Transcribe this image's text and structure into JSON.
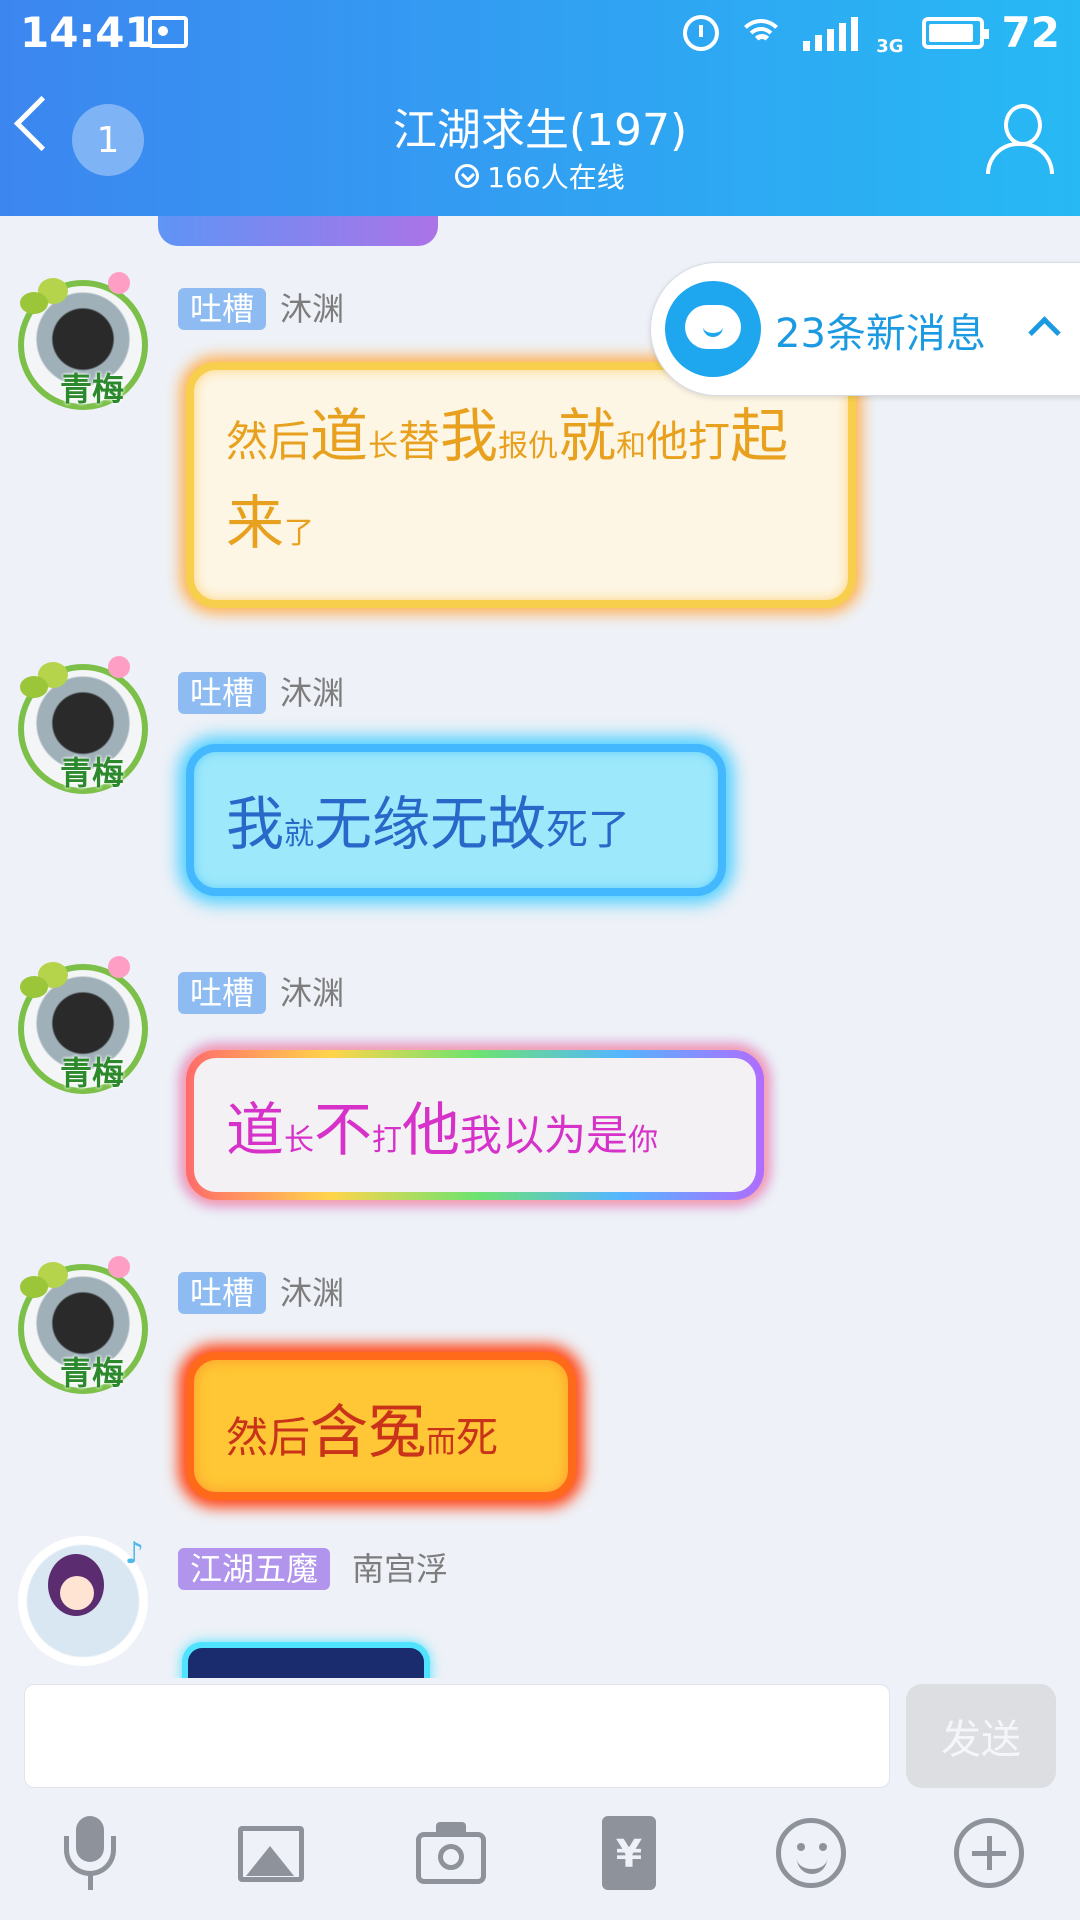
{
  "status_bar": {
    "time": "14:41",
    "network": "3G",
    "battery": "72"
  },
  "header": {
    "unread_count": "1",
    "title": "江湖求生(197)",
    "online": "166人在线"
  },
  "new_messages": {
    "label": "23条新消息"
  },
  "messages": [
    {
      "badge": "吐槽",
      "name": "沐渊",
      "segments": [
        {
          "t": "然后",
          "s": "m"
        },
        {
          "t": "道",
          "s": "l"
        },
        {
          "t": "长",
          "s": "s"
        },
        {
          "t": "替",
          "s": "m"
        },
        {
          "t": "我",
          "s": "l"
        },
        {
          "t": "报仇",
          "s": "s"
        },
        {
          "t": "就",
          "s": "l"
        },
        {
          "t": "和",
          "s": "s"
        },
        {
          "t": "他打",
          "s": "m"
        },
        {
          "t": "起来",
          "s": "l"
        },
        {
          "t": "了",
          "s": "s"
        }
      ]
    },
    {
      "badge": "吐槽",
      "name": "沐渊",
      "segments": [
        {
          "t": "我",
          "s": "l"
        },
        {
          "t": "就",
          "s": "s"
        },
        {
          "t": "无缘无故",
          "s": "l"
        },
        {
          "t": "死了",
          "s": "m"
        }
      ]
    },
    {
      "badge": "吐槽",
      "name": "沐渊",
      "segments": [
        {
          "t": "道",
          "s": "l"
        },
        {
          "t": "长",
          "s": "s"
        },
        {
          "t": "不",
          "s": "l"
        },
        {
          "t": "打",
          "s": "s"
        },
        {
          "t": "他",
          "s": "l"
        },
        {
          "t": "我以为是",
          "s": "m"
        },
        {
          "t": "你",
          "s": "s"
        }
      ]
    },
    {
      "badge": "吐槽",
      "name": "沐渊",
      "segments": [
        {
          "t": "然后",
          "s": "m"
        },
        {
          "t": "含冤",
          "s": "l"
        },
        {
          "t": "而",
          "s": "s"
        },
        {
          "t": "死",
          "s": "m"
        }
      ]
    },
    {
      "badge": "江湖五魔",
      "name": "南宫浮",
      "segments": []
    }
  ],
  "avatar_tag": "青梅",
  "composer": {
    "input_value": "",
    "send_label": "发送"
  },
  "toolbar": {
    "red_packet_symbol": "¥"
  },
  "colors": {
    "header_start": "#3c86f0",
    "header_end": "#27b9f4",
    "badge_blue": "#8ebbf1",
    "badge_purple": "#b194ec",
    "new_msg_text": "#1b99e1"
  }
}
